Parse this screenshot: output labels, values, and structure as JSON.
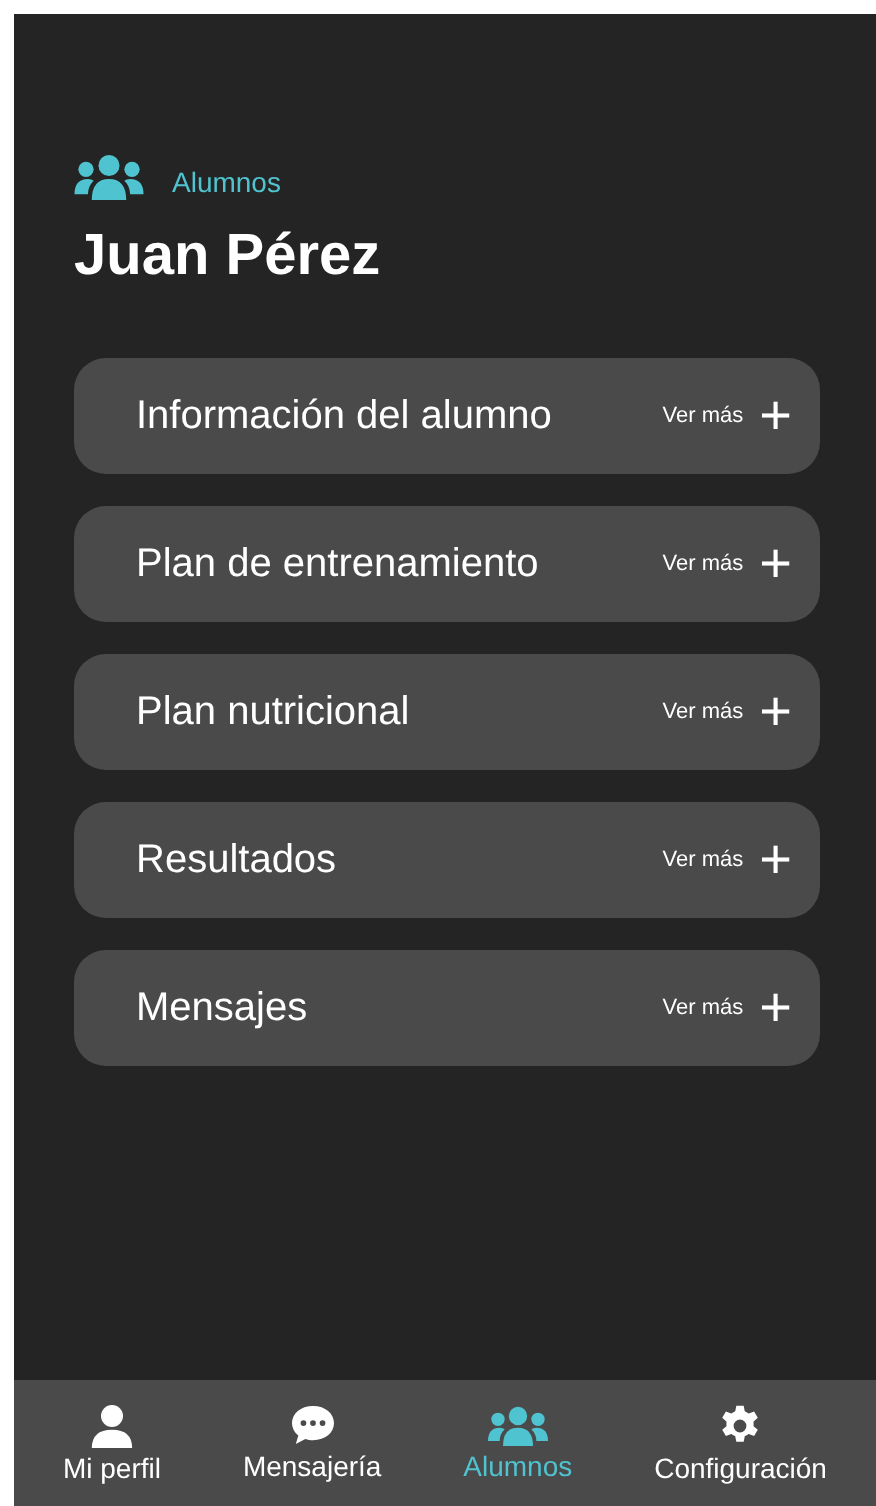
{
  "header": {
    "section": "Alumnos",
    "title": "Juan Pérez"
  },
  "sections": [
    {
      "label": "Información del alumno",
      "action": "Ver más",
      "icon": "+"
    },
    {
      "label": "Plan de entrenamiento",
      "action": "Ver más",
      "icon": "+"
    },
    {
      "label": "Plan nutricional",
      "action": "Ver más",
      "icon": "+"
    },
    {
      "label": "Resultados",
      "action": "Ver más",
      "icon": "+"
    },
    {
      "label": "Mensajes",
      "action": "Ver más",
      "icon": "+"
    }
  ],
  "nav": [
    {
      "label": "Mi perfil",
      "kind": "person",
      "selected": false
    },
    {
      "label": "Mensajería",
      "kind": "chat",
      "selected": false
    },
    {
      "label": "Alumnos",
      "kind": "group",
      "selected": true
    },
    {
      "label": "Configuración",
      "kind": "gear",
      "selected": false
    }
  ]
}
